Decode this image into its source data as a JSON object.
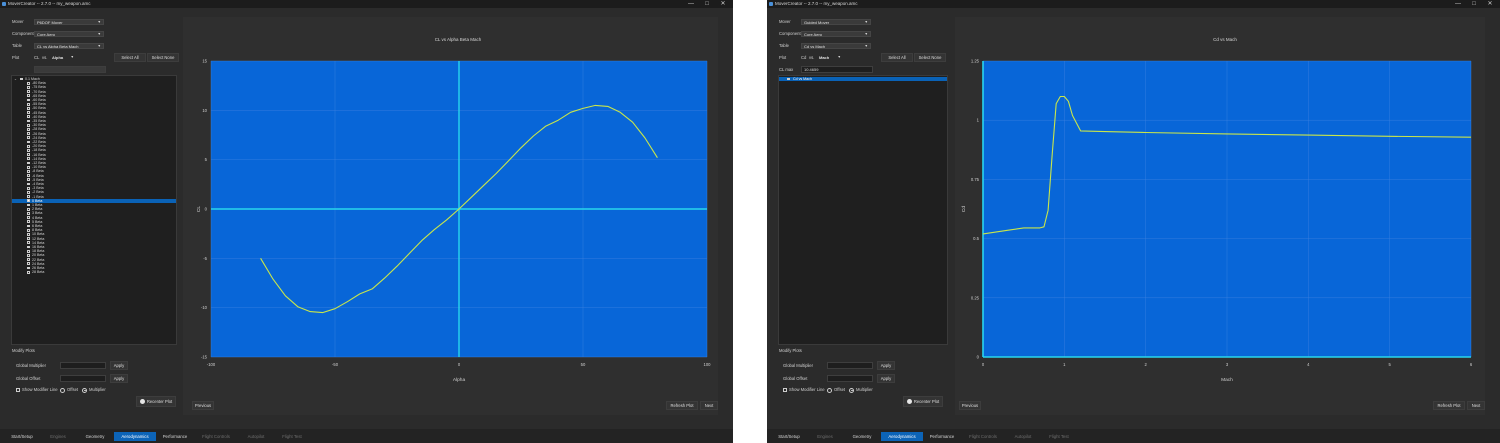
{
  "app": {
    "title": "MoverCreator -- 2.7.0 -- my_weapon.amc",
    "minimize": "—",
    "maximize": "□",
    "close": "✕"
  },
  "left": {
    "labels": {
      "mover": "Mover",
      "component": "Component",
      "table": "Table",
      "plot": "Plot"
    },
    "mover_value": "P6DOF Mover",
    "component_value": "Core Aero",
    "table_value": "CL vs Alpha Beta Mach",
    "plot_y": "CL",
    "plot_vs": "vs.",
    "plot_x": "Alpha",
    "select_all": "Select All",
    "select_none": "Select None",
    "tree_root": "0.1 Mach",
    "beta_items": [
      "-80 Beta",
      "-75 Beta",
      "-70 Beta",
      "-65 Beta",
      "-60 Beta",
      "-55 Beta",
      "-50 Beta",
      "-45 Beta",
      "-40 Beta",
      "-35 Beta",
      "-30 Beta",
      "-28 Beta",
      "-26 Beta",
      "-24 Beta",
      "-22 Beta",
      "-20 Beta",
      "-18 Beta",
      "-16 Beta",
      "-14 Beta",
      "-12 Beta",
      "-10 Beta",
      "-8 Beta",
      "-6 Beta",
      "-5 Beta",
      "-4 Beta",
      "-3 Beta",
      "-2 Beta",
      "-1 Beta",
      "0 Beta",
      "1 Beta",
      "2 Beta",
      "3 Beta",
      "4 Beta",
      "5 Beta",
      "6 Beta",
      "8 Beta",
      "10 Beta",
      "12 Beta",
      "14 Beta",
      "16 Beta",
      "18 Beta",
      "20 Beta",
      "22 Beta",
      "24 Beta",
      "26 Beta",
      "28 Beta"
    ],
    "selected_beta": "0 Beta",
    "chart_data": {
      "type": "line",
      "title": "CL vs Alpha Beta Mach",
      "xlabel": "Alpha",
      "ylabel": "CL",
      "xlim": [
        -100,
        100
      ],
      "ylim": [
        -15,
        15
      ],
      "xticks": [
        -100,
        -50,
        0,
        50,
        100
      ],
      "yticks": [
        15,
        10,
        5,
        0,
        -5,
        -10,
        -15
      ],
      "series": [
        {
          "values": [
            [
              -80,
              -5.0
            ],
            [
              -75,
              -7.1
            ],
            [
              -70,
              -8.8
            ],
            [
              -65,
              -9.9
            ],
            [
              -60,
              -10.4
            ],
            [
              -55,
              -10.5
            ],
            [
              -50,
              -10.1
            ],
            [
              -45,
              -9.4
            ],
            [
              -40,
              -8.6
            ],
            [
              -35,
              -8.1
            ],
            [
              -30,
              -7.0
            ],
            [
              -25,
              -5.8
            ],
            [
              -20,
              -4.5
            ],
            [
              -15,
              -3.2
            ],
            [
              -10,
              -2.1
            ],
            [
              -5,
              -1.1
            ],
            [
              0,
              0
            ],
            [
              5,
              1.2
            ],
            [
              10,
              2.4
            ],
            [
              15,
              3.6
            ],
            [
              20,
              4.9
            ],
            [
              25,
              6.2
            ],
            [
              30,
              7.4
            ],
            [
              35,
              8.4
            ],
            [
              40,
              9.0
            ],
            [
              45,
              9.8
            ],
            [
              50,
              10.2
            ],
            [
              55,
              10.5
            ],
            [
              60,
              10.4
            ],
            [
              65,
              9.8
            ],
            [
              70,
              8.8
            ],
            [
              75,
              7.2
            ],
            [
              80,
              5.2
            ]
          ]
        }
      ]
    }
  },
  "right": {
    "labels": {
      "mover": "Mover",
      "component": "Component",
      "table": "Table",
      "plot": "Plot",
      "cl_max": "CL max"
    },
    "mover_value": "Guided Mover",
    "component_value": "Core Aero",
    "table_value": "Cd vs Mach",
    "plot_y": "Cd",
    "plot_vs": "vs.",
    "plot_x": "Mach",
    "select_all": "Select All",
    "select_none": "Select None",
    "cl_max_value": "10.4659",
    "tree_item": "Cd vs Mach",
    "chart_data": {
      "type": "line",
      "title": "Cd vs Mach",
      "xlabel": "Mach",
      "ylabel": "Cd",
      "xlim": [
        0,
        6
      ],
      "ylim": [
        0,
        1.25
      ],
      "xticks": [
        0,
        1,
        2,
        3,
        4,
        5,
        6
      ],
      "yticks": [
        1.25,
        1,
        0.75,
        0.5,
        0.25,
        0
      ],
      "series": [
        {
          "values": [
            [
              0,
              0.52
            ],
            [
              0.3,
              0.535
            ],
            [
              0.5,
              0.545
            ],
            [
              0.6,
              0.545
            ],
            [
              0.7,
              0.545
            ],
            [
              0.75,
              0.55
            ],
            [
              0.8,
              0.62
            ],
            [
              0.85,
              0.85
            ],
            [
              0.9,
              1.07
            ],
            [
              0.95,
              1.1
            ],
            [
              1.0,
              1.1
            ],
            [
              1.05,
              1.08
            ],
            [
              1.1,
              1.02
            ],
            [
              1.2,
              0.955
            ],
            [
              1.5,
              0.952
            ],
            [
              2,
              0.948
            ],
            [
              3,
              0.942
            ],
            [
              4,
              0.937
            ],
            [
              5,
              0.932
            ],
            [
              6,
              0.928
            ]
          ]
        }
      ]
    }
  },
  "common": {
    "modify_plots": "Modify Plots",
    "global_multiplier": "Global Multiplier",
    "global_offset": "Global Offset",
    "apply": "Apply",
    "show_modifier_line": "Show Modifier Line",
    "offset": "Offset",
    "multiplier": "Multiplier",
    "recenter_plot": "Recenter Plot",
    "previous": "Previous",
    "refresh_plot": "Refresh Plot",
    "next": "Next",
    "tabs": [
      "Start/Setup",
      "Engines",
      "Geometry",
      "Aerodynamics",
      "Performance",
      "Flight Controls",
      "Autopilot",
      "Flight Test"
    ],
    "active_tab": "Aerodynamics",
    "disabled_tabs": [
      "Engines",
      "Flight Controls",
      "Autopilot",
      "Flight Test"
    ]
  },
  "colors": {
    "plot_bg": "#0866d8",
    "curve": "#c9e64a",
    "axis_highlight": "#29d6ee",
    "grid": "#3f83e0",
    "active_tab": "#0c64b8",
    "selection": "#0a62b6"
  }
}
